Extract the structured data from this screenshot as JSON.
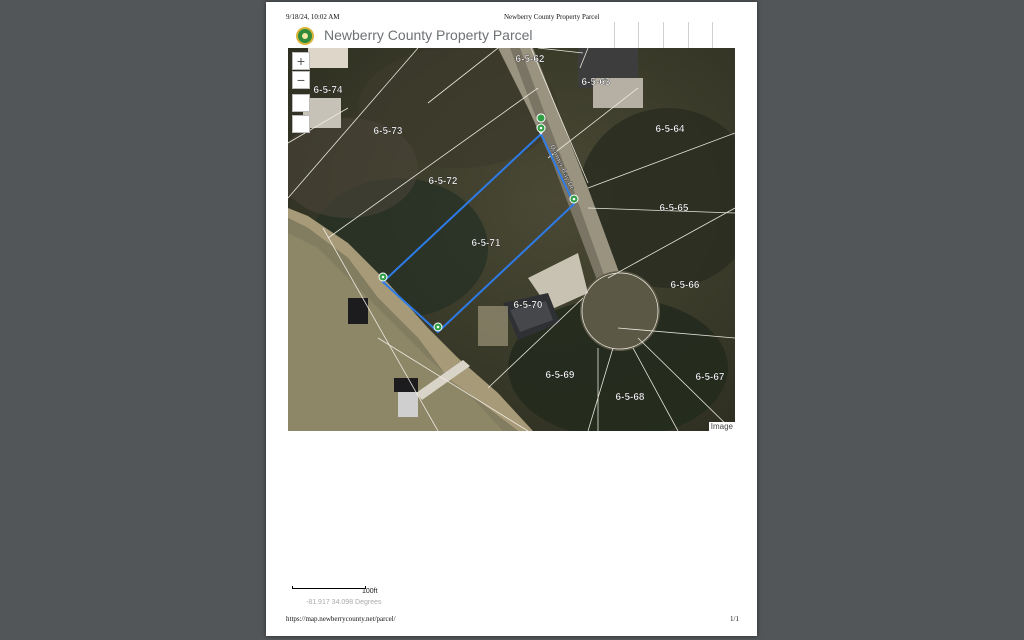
{
  "print_header": {
    "date": "9/18/24, 10:02 AM",
    "title": "Newberry County Property Parcel"
  },
  "app": {
    "title": "Newberry County Property Parcel",
    "logo_icon": "county-seal-icon"
  },
  "map": {
    "zoom_in": "+",
    "zoom_out": "−",
    "attribution": "Image",
    "street_label": "Danner Bay Dr",
    "parcels": [
      "6-5-62",
      "6-5-63",
      "6-5-74",
      "6-5-73",
      "6-5-64",
      "6-5-72",
      "6-5-65",
      "6-5-71",
      "6-5-66",
      "6-5-70",
      "6-5-69",
      "6-5-67",
      "6-5-68"
    ],
    "selection_color": "#2d7be6",
    "marker_color": "#2f9e44"
  },
  "scale": {
    "label": "100ft",
    "coords": "-81.917 34.098 Degrees"
  },
  "print_footer": {
    "url": "https://map.newberrycounty.net/parcel/",
    "page": "1/1"
  }
}
